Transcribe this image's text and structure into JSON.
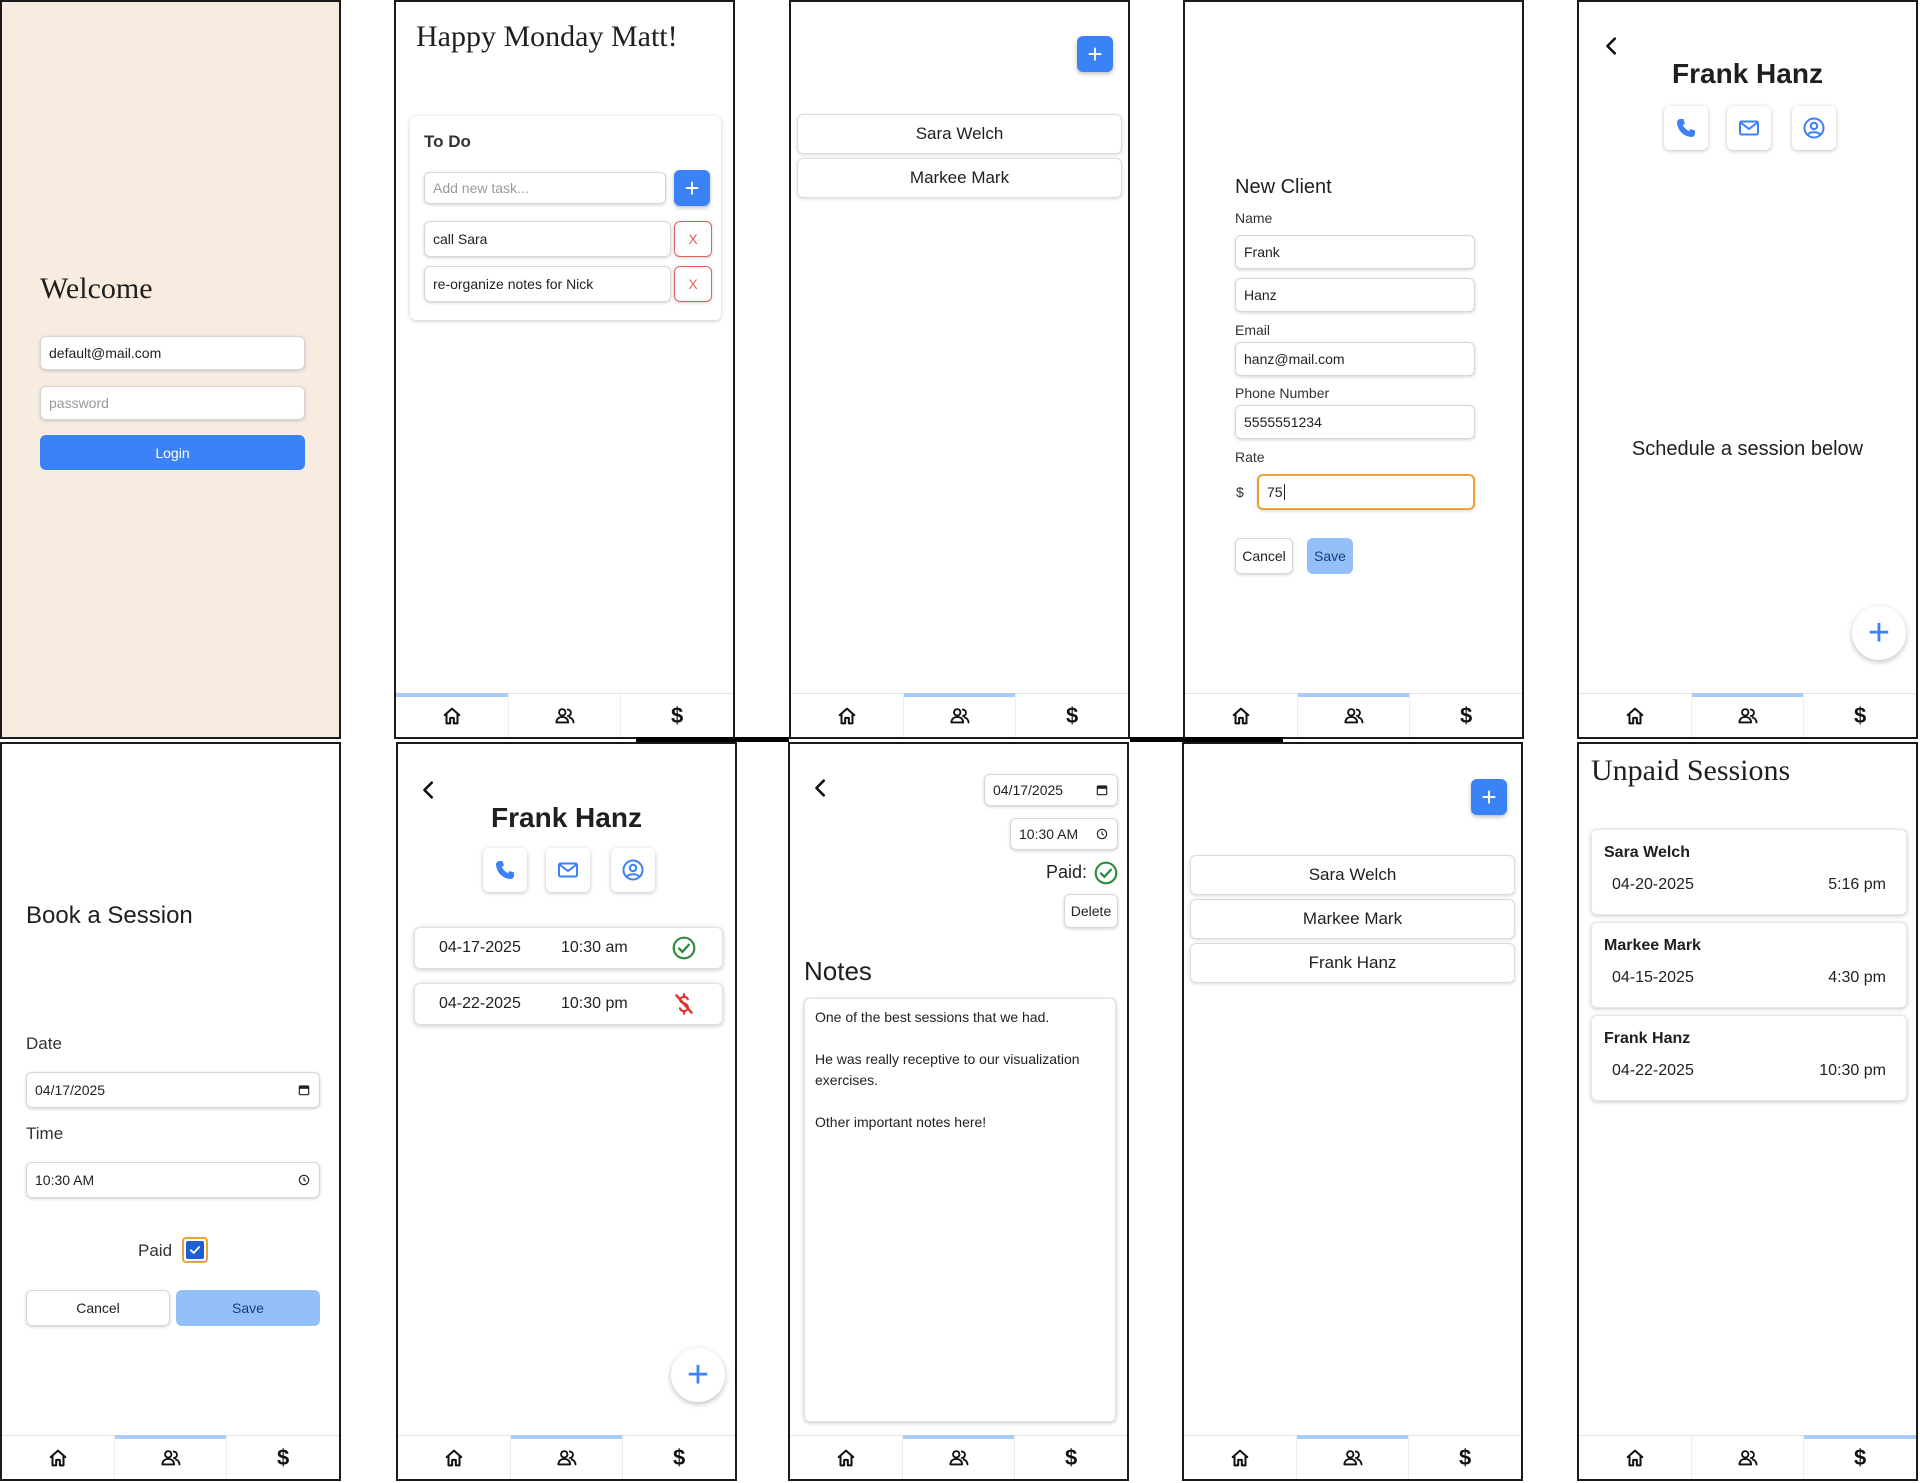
{
  "colors": {
    "accent": "#3b82f6",
    "accent_pale": "#93c0f8",
    "login_bg": "#f8ece1",
    "danger": "#e0605a",
    "success": "#2e8b3d",
    "focus": "#e8a33a"
  },
  "login": {
    "title": "Welcome",
    "email_value": "default@mail.com",
    "password_placeholder": "password",
    "login_label": "Login"
  },
  "home": {
    "greeting": "Happy Monday Matt!",
    "todo_title": "To Do",
    "task_placeholder": "Add new task...",
    "add_icon": "+",
    "tasks": [
      {
        "text": "call Sara",
        "delete": "X"
      },
      {
        "text": "re-organize notes for Nick",
        "delete": "X"
      }
    ]
  },
  "clients1": {
    "add_icon": "+",
    "clients": [
      "Sara Welch",
      "Markee Mark"
    ]
  },
  "new_client": {
    "title": "New Client",
    "name_label": "Name",
    "first_value": "Frank",
    "last_value": "Hanz",
    "email_label": "Email",
    "email_value": "hanz@mail.com",
    "phone_label": "Phone Number",
    "phone_value": "5555551234",
    "rate_label": "Rate",
    "currency": "$",
    "rate_value": "75",
    "cancel_label": "Cancel",
    "save_label": "Save"
  },
  "client_empty": {
    "name": "Frank Hanz",
    "message": "Schedule a session below",
    "fab": "+"
  },
  "book": {
    "title": "Book a Session",
    "date_label": "Date",
    "date_value": "04/17/2025",
    "time_label": "Time",
    "time_value": "10:30 AM",
    "paid_label": "Paid",
    "cancel_label": "Cancel",
    "save_label": "Save"
  },
  "client_sessions": {
    "name": "Frank Hanz",
    "fab": "+",
    "sessions": [
      {
        "date": "04-17-2025",
        "time": "10:30 am",
        "status": "paid"
      },
      {
        "date": "04-22-2025",
        "time": "10:30 pm",
        "status": "unpaid"
      }
    ]
  },
  "session_detail": {
    "date_value": "04/17/2025",
    "time_value": "10:30 AM",
    "paid_label": "Paid:",
    "delete_label": "Delete",
    "notes_title": "Notes",
    "notes_line1": "One of the best sessions that we had.",
    "notes_line2": "He was really receptive to our visualization exercises.",
    "notes_line3": "Other important notes here!"
  },
  "clients2": {
    "add_icon": "+",
    "clients": [
      "Sara Welch",
      "Markee Mark",
      "Frank Hanz"
    ]
  },
  "unpaid": {
    "title": "Unpaid Sessions",
    "items": [
      {
        "name": "Sara Welch",
        "date": "04-20-2025",
        "time": "5:16 pm"
      },
      {
        "name": "Markee Mark",
        "date": "04-15-2025",
        "time": "4:30 pm"
      },
      {
        "name": "Frank Hanz",
        "date": "04-22-2025",
        "time": "10:30 pm"
      }
    ]
  },
  "tabbar": {
    "home_icon": "home-icon",
    "clients_icon": "people-icon",
    "payments_icon": "dollar-icon",
    "dollar_glyph": "$"
  }
}
